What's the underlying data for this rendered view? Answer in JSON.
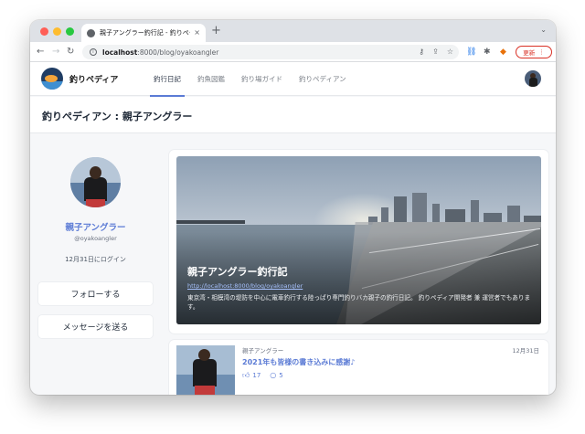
{
  "browser": {
    "tab_title": "親子アングラー釣行記 - 釣りペディ",
    "tab_close": "×",
    "new_tab": "+",
    "tab_menu": "⌄",
    "url_host": "localhost",
    "url_path": ":8000/blog/oyakoangler",
    "update_label": "更新",
    "update_menu": "⋮"
  },
  "site": {
    "brand": "釣りペディア",
    "nav": [
      "釣行日記",
      "釣魚図鑑",
      "釣り場ガイド",
      "釣りペディアン"
    ],
    "active_nav_index": 0
  },
  "page": {
    "title": "釣りペディアン : 親子アングラー"
  },
  "profile": {
    "name": "親子アングラー",
    "handle": "@oyakoangler",
    "last_login": "12月31日にログイン",
    "follow_label": "フォローする",
    "message_label": "メッセージを送る"
  },
  "hero": {
    "title": "親子アングラー釣行記",
    "url": "http://localhost:8000/blog/oyakoangler",
    "description": "東京湾・相模湾の堤防を中心に電車釣行する陸っぱり専門釣りバカ親子の釣行日記。 釣りペディア開発者 兼 運営者でもあります。"
  },
  "post": {
    "author": "親子アングラー",
    "date": "12月31日",
    "title": "2021年も皆様の書き込みに感謝♪",
    "likes": "17",
    "comments": "5"
  },
  "colors": {
    "accent": "#5b7bd5",
    "update": "#d93025"
  }
}
